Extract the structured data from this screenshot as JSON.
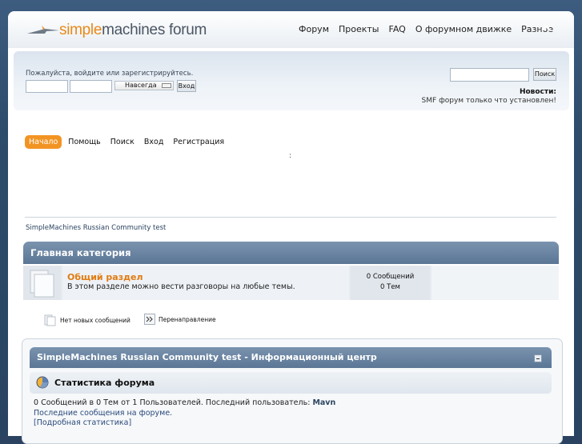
{
  "header": {
    "logo_text_accent": "simple",
    "logo_text_rest": "machines",
    "logo_text_forum": " forum",
    "menu": [
      "Форум",
      "Проекты",
      "FAQ",
      "О форумном движке",
      "Разное"
    ]
  },
  "userbar": {
    "login_message": "Пожалуйста, войдите или зарегистрируйтесь.",
    "session_select": "Навсегда",
    "login_button": "Вход",
    "search_button": "Поиск",
    "news_label": "Новости:",
    "news_text": "SMF форум только что установлен!"
  },
  "nav": {
    "tabs": [
      "Начало",
      "Помощь",
      "Поиск",
      "Вход",
      "Регистрация"
    ],
    "colon": ":"
  },
  "breadcrumb": "SimpleMachines Russian Community test",
  "category": {
    "title": "Главная категория",
    "board_name": "Общий раздел",
    "board_desc": "В этом разделе можно вести разговоры на любые темы.",
    "posts": "0 Сообщений",
    "topics": "0 Тем"
  },
  "legend": {
    "no_new": "Нет новых сообщений",
    "redirect": "Перенаправление"
  },
  "info_center": {
    "title": "SimpleMachines Russian Community test - Информационный центр",
    "stats_title": "Статистика форума",
    "stats_line_prefix": "0 Сообщений в 0 Тем от 1 Пользователей. Последний пользователь:",
    "latest_member": "Mavn",
    "recent_link": "Последние сообщения на форуме.",
    "detailed_link": "[Подробная статистика]"
  },
  "colors": {
    "accent_orange": "#f29423",
    "header_blue": "#5b7696",
    "board_link": "#e27b11"
  }
}
